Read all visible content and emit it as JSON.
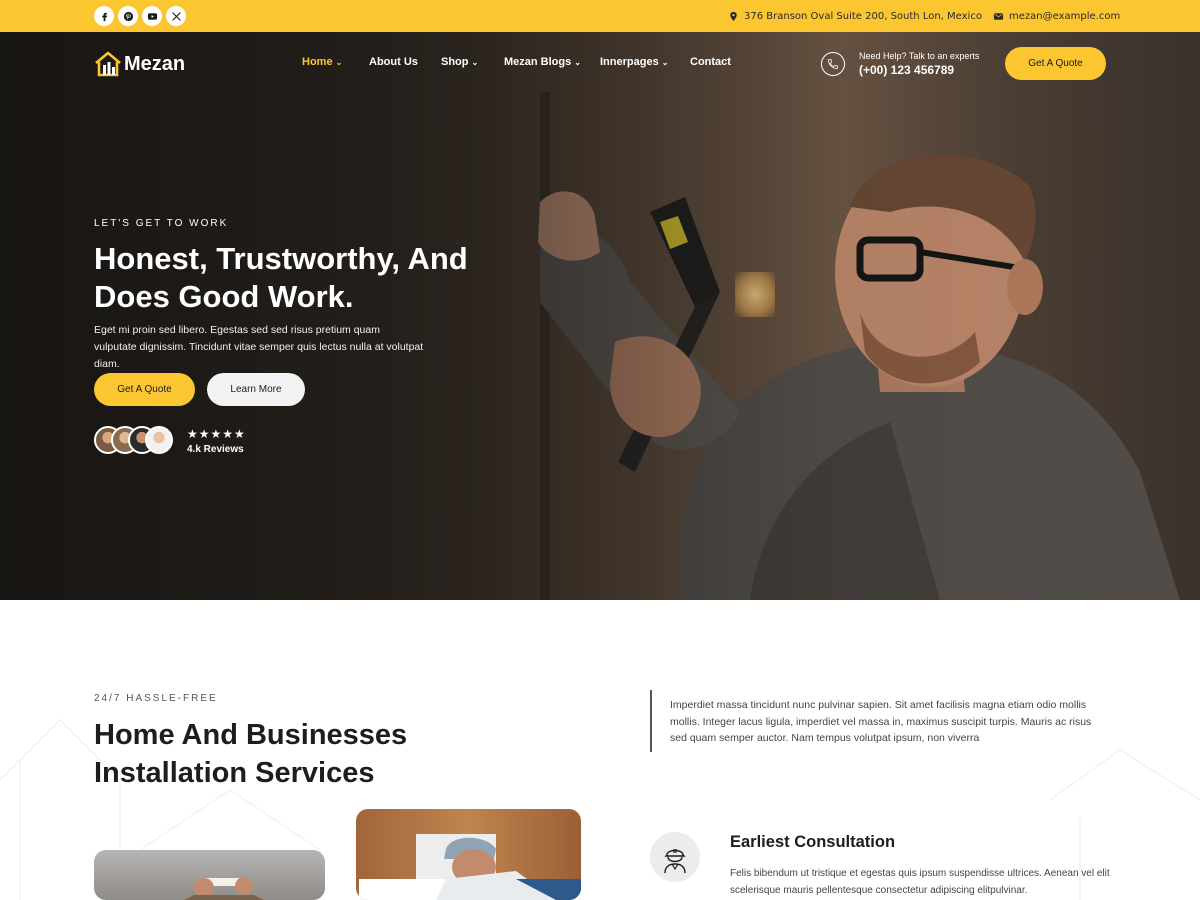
{
  "topbar": {
    "socials": [
      {
        "icon": "facebook-icon"
      },
      {
        "icon": "pinterest-icon"
      },
      {
        "icon": "youtube-icon"
      },
      {
        "icon": "x-twitter-icon"
      }
    ],
    "address": "376 Branson Oval Suite 200, South Lon, Mexico",
    "email": "mezan@example.com",
    "accent_color": "#fcc631"
  },
  "header": {
    "logo_text": "Mezan",
    "nav": [
      {
        "label": "Home",
        "active": true,
        "dropdown": true
      },
      {
        "label": "About Us",
        "active": false,
        "dropdown": false
      },
      {
        "label": "Shop",
        "active": false,
        "dropdown": true
      },
      {
        "label": "Mezan Blogs",
        "active": false,
        "dropdown": true
      },
      {
        "label": "Innerpages",
        "active": false,
        "dropdown": true
      },
      {
        "label": "Contact",
        "active": false,
        "dropdown": false
      }
    ],
    "help_label": "Need Help? Talk to an experts",
    "help_phone": "(+00) 123 456789",
    "cta_label": "Get A Quote"
  },
  "hero": {
    "kicker": "LET'S GET TO WORK",
    "title": "Honest, Trustworthy, And Does Good Work.",
    "text": "Eget mi proin sed libero. Egestas sed sed risus pretium quam vulputate dignissim. Tincidunt vitae semper quis lectus nulla at volutpat diam.",
    "primary_button": "Get A Quote",
    "secondary_button": "Learn More",
    "rating_stars": 5,
    "stars_text": "★★★★★",
    "reviews_label": "4.k Reviews"
  },
  "services": {
    "kicker": "24/7 HASSLE-FREE",
    "title": "Home And Businesses Installation Services",
    "text": "Imperdiet massa tincidunt nunc pulvinar sapien. Sit amet facilisis magna etiam odio mollis mollis. Integer lacus ligula, imperdiet vel massa in, maximus suscipit turpis. Mauris ac risus sed quam semper auctor. Nam tempus volutpat ipsum, non viverra",
    "feature": {
      "icon": "worker-helmet-icon",
      "title": "Earliest Consultation",
      "text": "Felis bibendum ut tristique et egestas quis ipsum suspendisse ultrices. Aenean vel elit scelerisque mauris pellentesque consectetur adipiscing elitpulvinar."
    }
  }
}
